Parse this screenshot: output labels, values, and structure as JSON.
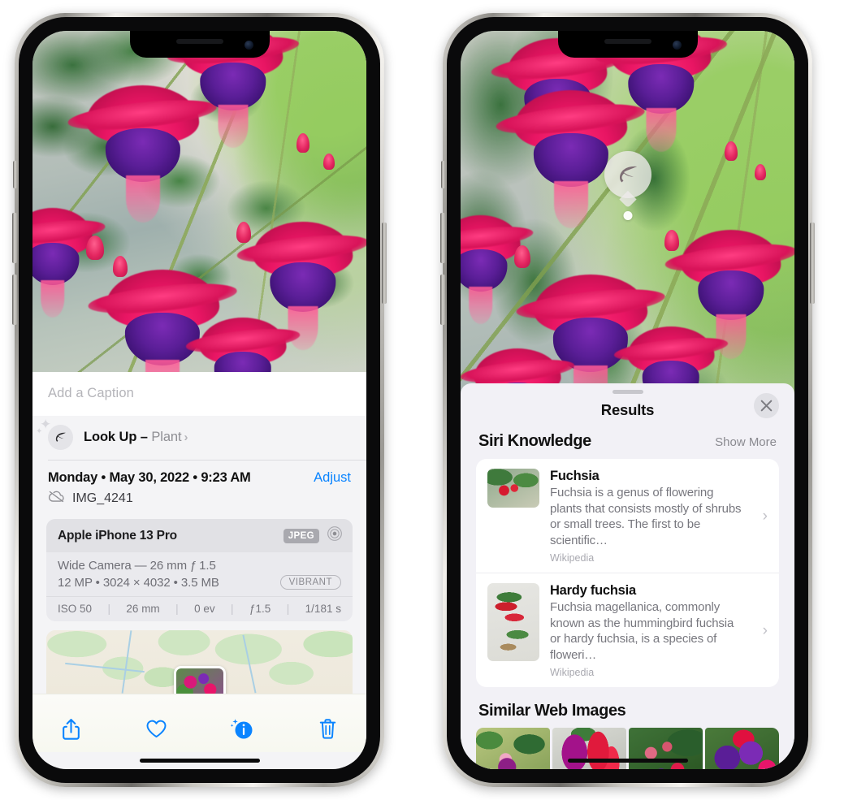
{
  "left_phone": {
    "caption": {
      "placeholder": "Add a Caption",
      "value": ""
    },
    "lookup": {
      "label": "Look Up – ",
      "subject": "Plant",
      "chevron": "›",
      "icon": "leaf-icon"
    },
    "meta": {
      "date": "Monday • May 30, 2022 • 9:23 AM",
      "adjust_label": "Adjust",
      "filename": "IMG_4241",
      "cloud_icon": "icloud-slash-icon"
    },
    "exif": {
      "device": "Apple iPhone 13 Pro",
      "format_badge": "JPEG",
      "aperture_icon": "aperture-icon",
      "lens_line": "Wide Camera — 26 mm ƒ 1.5",
      "size_line": "12 MP • 3024 × 4032 • 3.5 MB",
      "style_badge": "VIBRANT",
      "stats": [
        "ISO 50",
        "26 mm",
        "0 ev",
        "ƒ1.5",
        "1/181 s"
      ],
      "separator": "|"
    },
    "toolbar": [
      {
        "name": "share-button",
        "icon": "share-icon"
      },
      {
        "name": "favorite-button",
        "icon": "heart-icon"
      },
      {
        "name": "info-button",
        "icon": "info-sparkle-icon"
      },
      {
        "name": "delete-button",
        "icon": "trash-icon"
      }
    ],
    "accent_color": "#0a84ff"
  },
  "right_phone": {
    "photo_badge": {
      "icon": "leaf-icon",
      "name": "visual-lookup-leaf-badge"
    },
    "sheet": {
      "title": "Results",
      "close_icon": "close-icon",
      "grabber": "sheet-grabber"
    },
    "siri_knowledge": {
      "title": "Siri Knowledge",
      "action": "Show More",
      "items": [
        {
          "title": "Fuchsia",
          "description": "Fuchsia is a genus of flowering plants that consists mostly of shrubs or small trees. The first to be scientific…",
          "source": "Wikipedia",
          "chevron": "›"
        },
        {
          "title": "Hardy fuchsia",
          "description": "Fuchsia magellanica, commonly known as the hummingbird fuchsia or hardy fuchsia, is a species of floweri…",
          "source": "Wikipedia",
          "chevron": "›"
        }
      ]
    },
    "similar_web_images": {
      "title": "Similar Web Images",
      "thumbs": [
        "fuchsia-thumb-1",
        "fuchsia-thumb-2",
        "fuchsia-thumb-3",
        "fuchsia-thumb-4"
      ]
    }
  }
}
